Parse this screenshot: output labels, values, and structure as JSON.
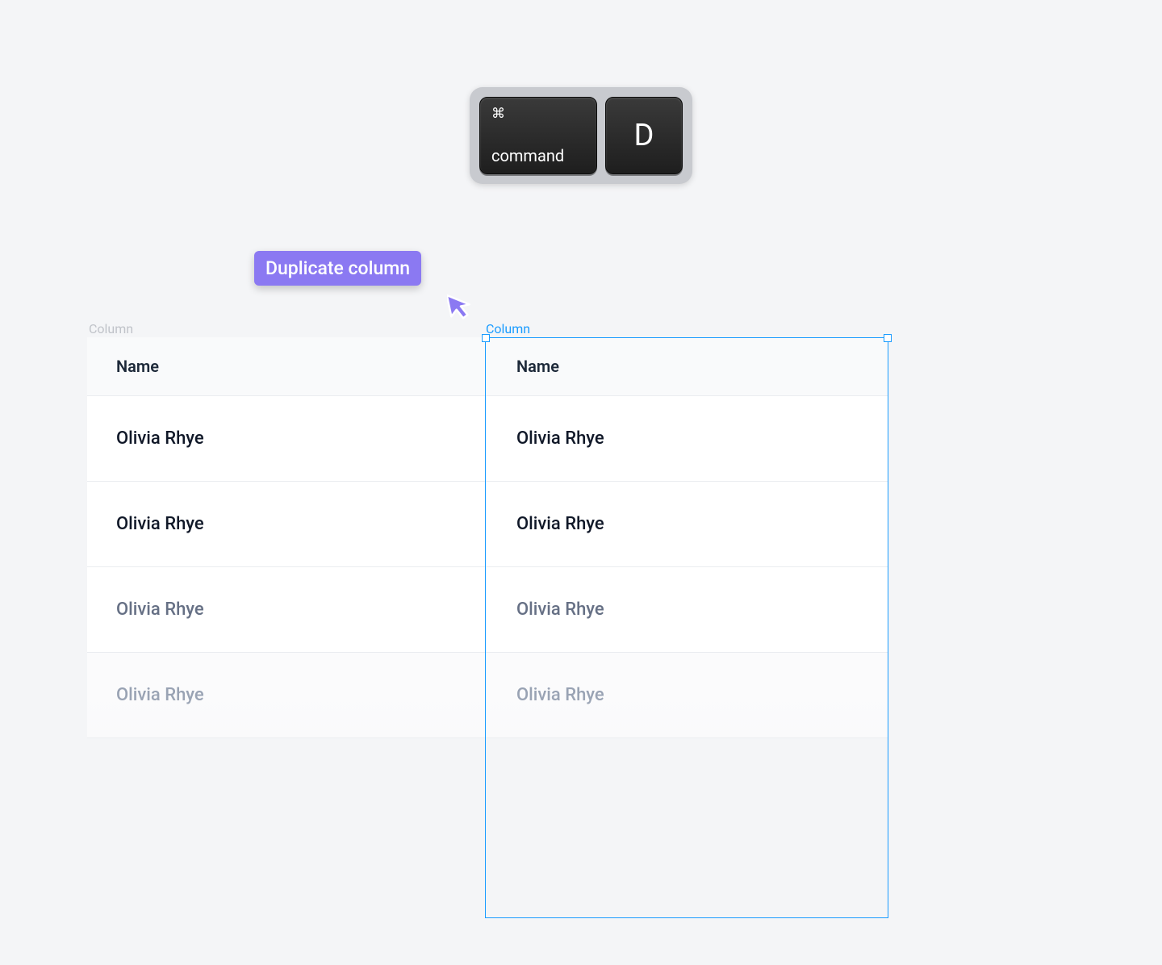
{
  "shortcut": {
    "command_glyph": "⌘",
    "command_label": "command",
    "key": "D"
  },
  "tooltip": {
    "label": "Duplicate column"
  },
  "columns": {
    "left_label": "Column",
    "right_label": "Column"
  },
  "table": {
    "header": "Name",
    "rows": [
      "Olivia Rhye",
      "Olivia Rhye",
      "Olivia Rhye",
      "Olivia Rhye"
    ]
  },
  "selection": {
    "color": "#1a9cff"
  }
}
